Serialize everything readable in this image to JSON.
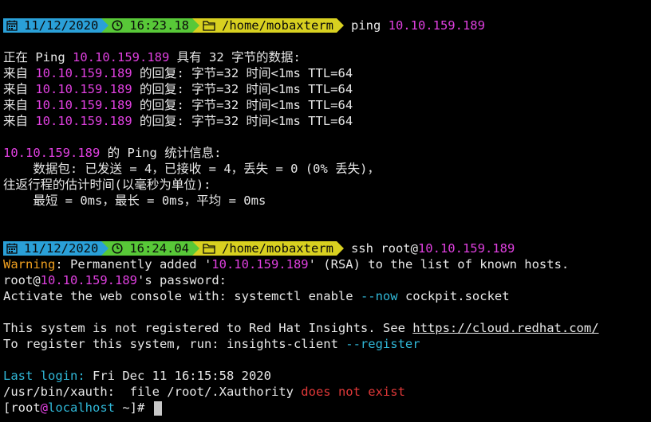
{
  "prompt1": {
    "date": "11/12/2020",
    "time": "16:23.18",
    "path": "/home/mobaxterm",
    "cmd": "ping ",
    "cmd_ip": "10.10.159.189"
  },
  "ping": {
    "header_a": "正在 Ping ",
    "ip": "10.10.159.189",
    "header_b": " 具有 32 字节的数据:",
    "reply_a": "来自 ",
    "reply_b": " 的回复: 字节=32 时间<1ms TTL=64",
    "stats_ip": "10.10.159.189",
    "stats_title": " 的 Ping 统计信息:",
    "packets": "    数据包: 已发送 = 4，已接收 = 4，丢失 = 0 (0% 丢失)，",
    "rtt_title": "往返行程的估计时间(以毫秒为单位):",
    "rtt": "    最短 = 0ms，最长 = 0ms，平均 = 0ms"
  },
  "prompt2": {
    "date": "11/12/2020",
    "time": "16:24.04",
    "path": "/home/mobaxterm",
    "cmd": "ssh root@",
    "cmd_ip": "10.10.159.189"
  },
  "ssh": {
    "warning_label": "Warning",
    "warning_a": ": Permanently added '",
    "warning_ip": "10.10.159.189",
    "warning_b": "' (RSA) to the list of known hosts.",
    "pw_a": "root@",
    "pw_ip": "10.10.159.189",
    "pw_b": "'s password:",
    "activate_a": "Activate the web console with: systemctl enable ",
    "activate_flag": "--now",
    "activate_b": " cockpit.socket",
    "reg_a": "This system is not registered to Red Hat Insights. See ",
    "reg_link": "https://cloud.redhat.com/",
    "reg2_a": "To register this system, run: insights-client ",
    "reg2_flag": "--register",
    "last_label": "Last login:",
    "last_value": " Fri Dec 11 16:15:58 2020",
    "xauth_a": "/usr/bin/xauth:  file /root/.Xauthority ",
    "xauth_b": "does not exist",
    "final_a": "[root",
    "final_at": "@",
    "final_host": "localhost",
    "final_b": " ~]# "
  },
  "icons": {
    "calendar": "calendar-icon",
    "clock": "clock-icon",
    "folder": "folder-icon"
  },
  "colors": {
    "date_bg": "#2aa0d8",
    "time_bg": "#58c838",
    "path_bg": "#d8d020",
    "ip": "#e040e0",
    "warning": "#f0a020",
    "flag": "#30b8d8",
    "error": "#e03838"
  }
}
